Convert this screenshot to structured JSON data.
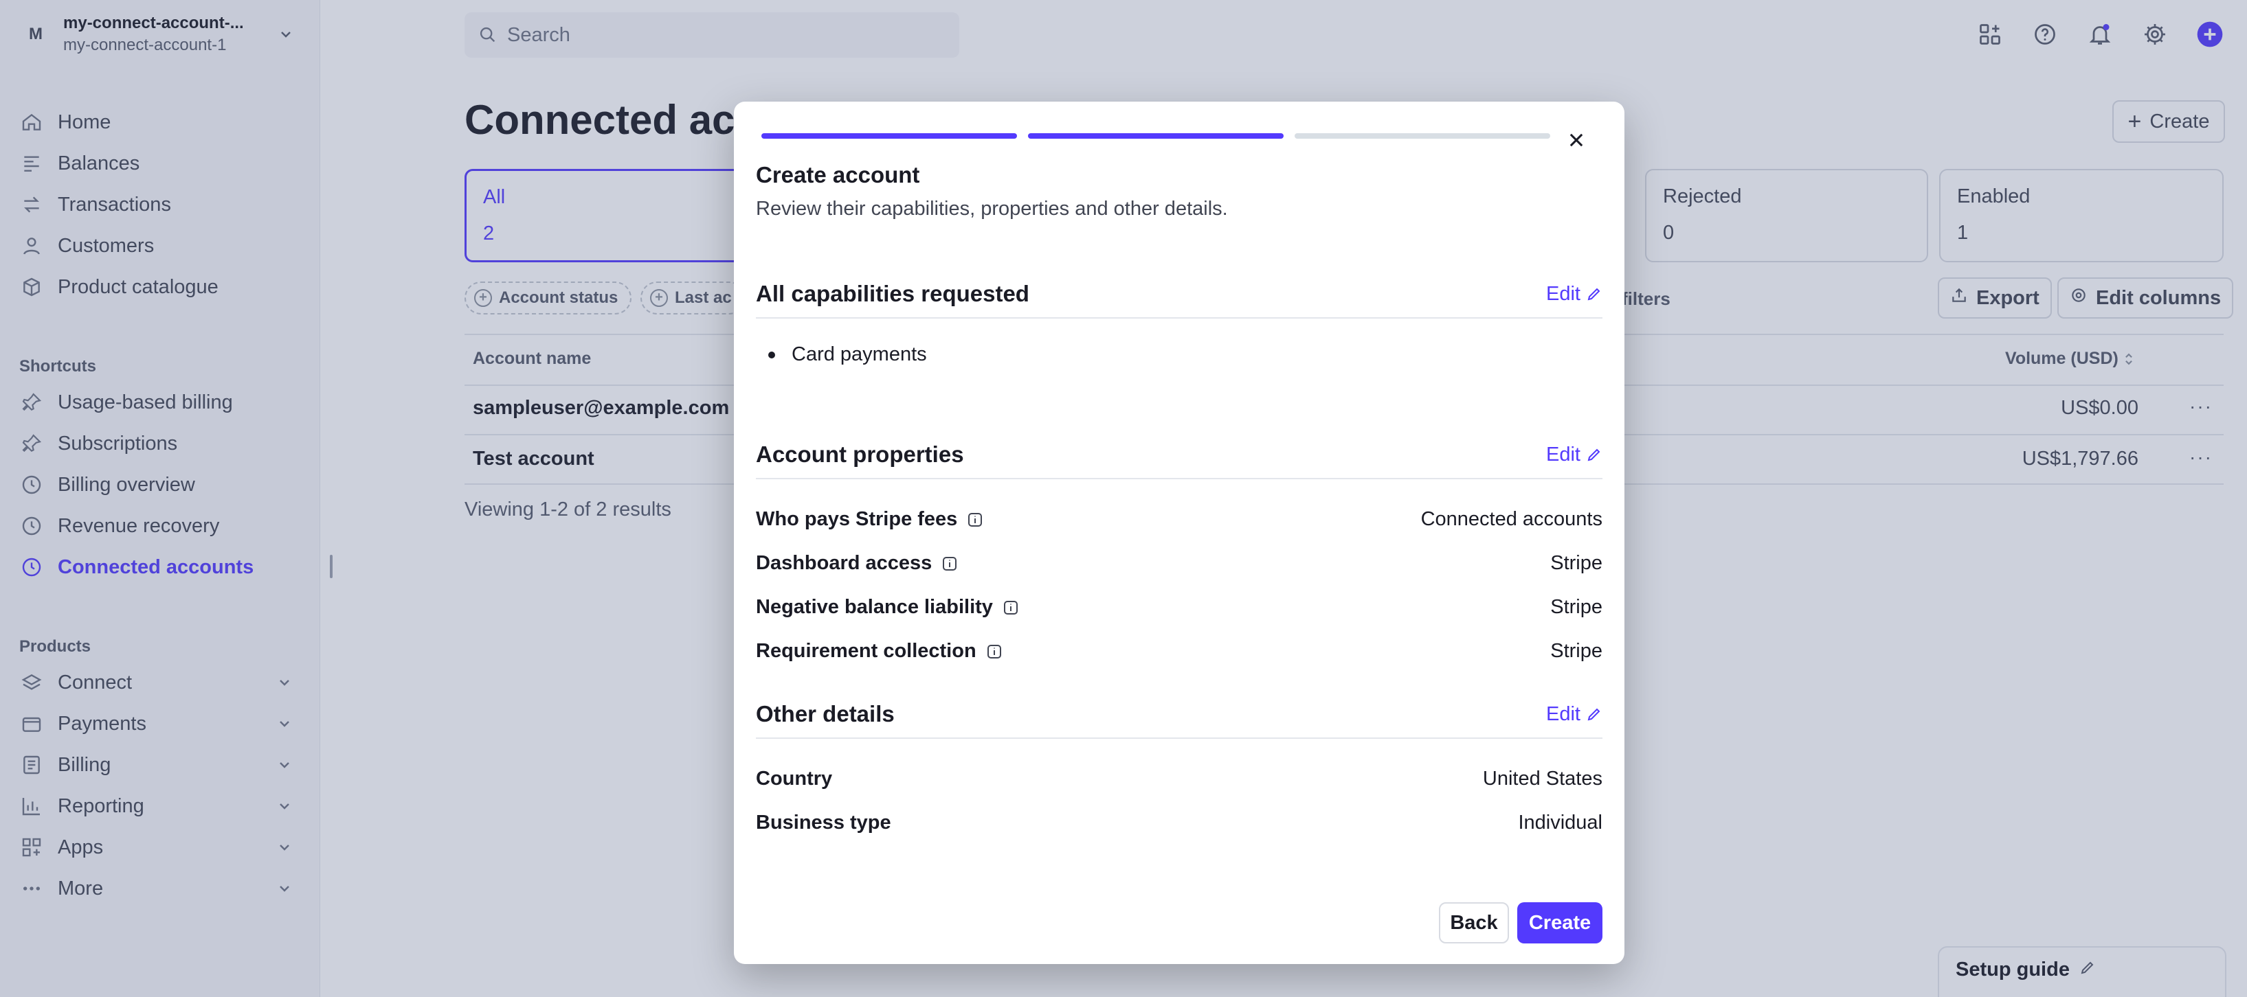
{
  "account": {
    "avatar": "M",
    "name": "my-connect-account-...",
    "sub": "my-connect-account-1"
  },
  "nav": {
    "home": "Home",
    "balances": "Balances",
    "transactions": "Transactions",
    "customers": "Customers",
    "product_catalogue": "Product catalogue"
  },
  "shortcuts": {
    "title": "Shortcuts",
    "usage_billing": "Usage-based billing",
    "subscriptions": "Subscriptions",
    "billing_overview": "Billing overview",
    "revenue_recovery": "Revenue recovery",
    "connected_accounts": "Connected accounts"
  },
  "products": {
    "title": "Products",
    "connect": "Connect",
    "payments": "Payments",
    "billing": "Billing",
    "reporting": "Reporting",
    "apps": "Apps",
    "more": "More"
  },
  "topbar": {
    "search_placeholder": "Search",
    "icons": [
      "apps-icon",
      "help-icon",
      "bell-icon",
      "gear-icon",
      "plus-circle-icon"
    ]
  },
  "page": {
    "title": "Connected accounts",
    "create_label": "Create",
    "filters": [
      {
        "label": "All",
        "count": "2"
      },
      {
        "label": "Rejected",
        "count": "0"
      },
      {
        "label": "Enabled",
        "count": "1"
      }
    ],
    "pills": [
      "Account status",
      "Last ac"
    ],
    "clear_filters": "filters",
    "export_label": "Export",
    "edit_columns_label": "Edit columns",
    "columns": {
      "account_name": "Account name",
      "volume": "Volume (USD)"
    },
    "rows": [
      {
        "name": "sampleuser@example.com",
        "volume": "US$0.00"
      },
      {
        "name": "Test account",
        "volume": "US$1,797.66"
      }
    ],
    "viewing": "Viewing 1-2 of 2 results",
    "setup_guide": "Setup guide"
  },
  "modal": {
    "progress": [
      1,
      1,
      0
    ],
    "title": "Create account",
    "subtitle": "Review their capabilities, properties and other details.",
    "capabilities": {
      "title": "All capabilities requested",
      "edit": "Edit",
      "items": [
        "Card payments"
      ]
    },
    "properties": {
      "title": "Account properties",
      "edit": "Edit",
      "rows": [
        {
          "key": "Who pays Stripe fees",
          "value": "Connected accounts"
        },
        {
          "key": "Dashboard access",
          "value": "Stripe"
        },
        {
          "key": "Negative balance liability",
          "value": "Stripe"
        },
        {
          "key": "Requirement collection",
          "value": "Stripe"
        }
      ]
    },
    "other": {
      "title": "Other details",
      "edit": "Edit",
      "rows": [
        {
          "key": "Country",
          "value": "United States"
        },
        {
          "key": "Business type",
          "value": "Individual"
        }
      ]
    },
    "back_label": "Back",
    "create_label": "Create"
  },
  "colors": {
    "accent": "#533afd",
    "overlay": "#4a5b82"
  }
}
